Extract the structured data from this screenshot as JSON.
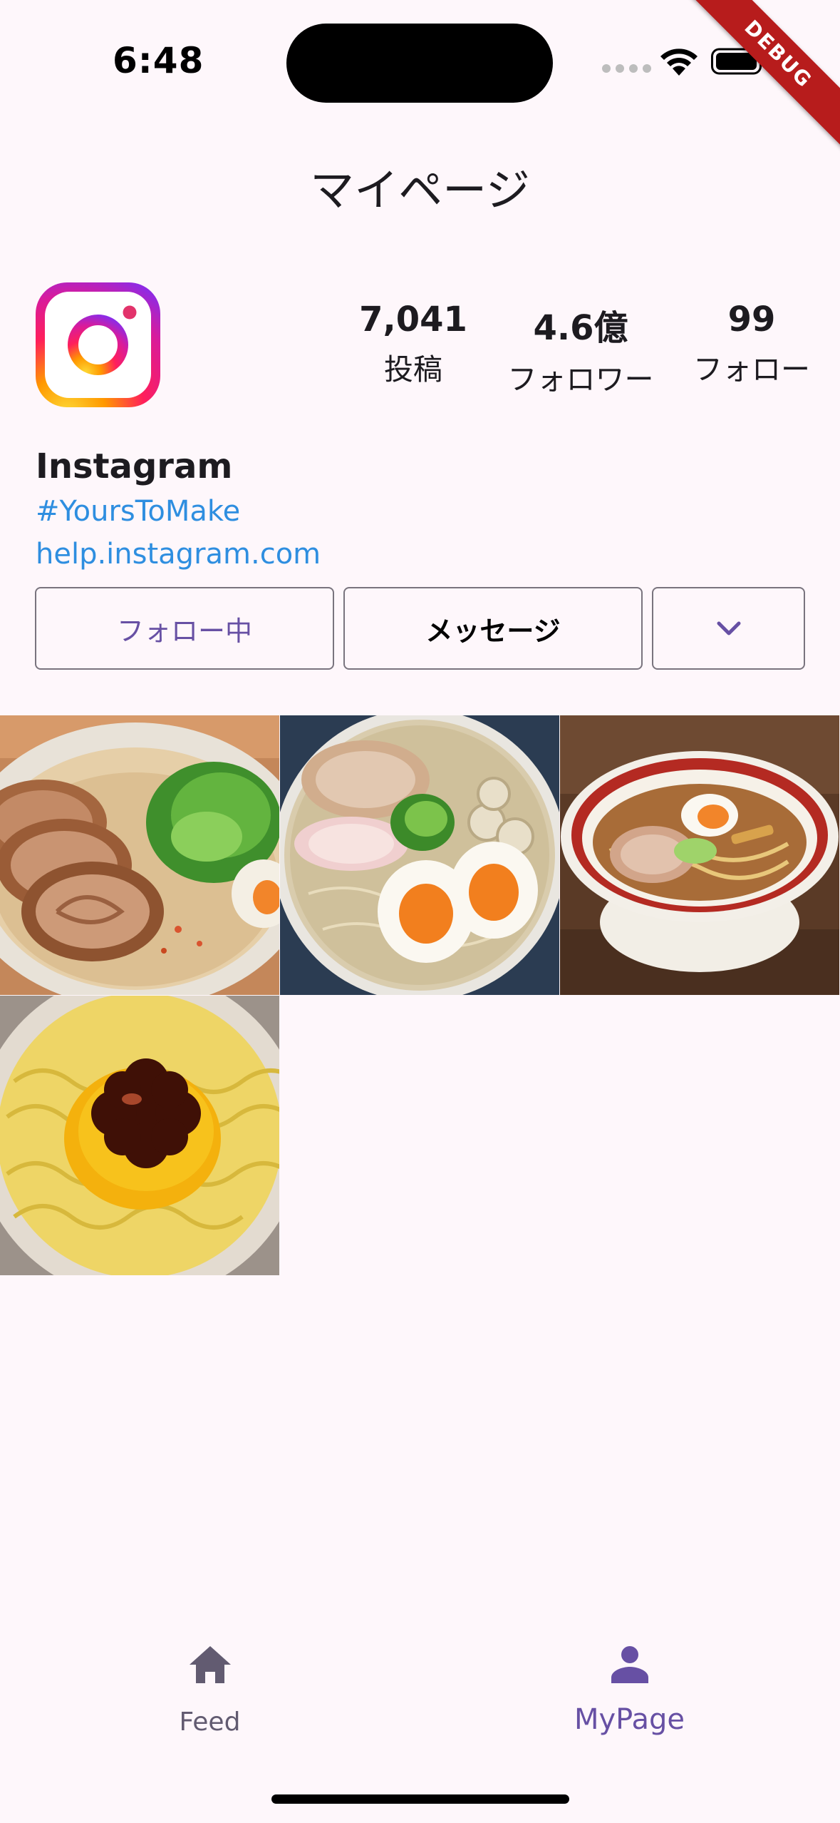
{
  "status_bar": {
    "time": "6:48"
  },
  "debug_label": "DEBUG",
  "page": {
    "title": "マイページ"
  },
  "profile": {
    "name": "Instagram",
    "hashtag": "#YoursToMake",
    "link": "help.instagram.com",
    "stats": [
      {
        "value": "7,041",
        "label": "投稿"
      },
      {
        "value": "4.6億",
        "label": "フォロワー"
      },
      {
        "value": "99",
        "label": "フォロー"
      }
    ]
  },
  "actions": {
    "follow_label": "フォロー中",
    "message_label": "メッセージ",
    "more_icon": "chevron-down-icon"
  },
  "posts": [
    {
      "icon": "ramen-photo-chashu"
    },
    {
      "icon": "ramen-photo-eggs"
    },
    {
      "icon": "ramen-photo-shoyu"
    },
    {
      "icon": "ramen-photo-pudding"
    }
  ],
  "nav": {
    "items": [
      {
        "label": "Feed",
        "icon": "home-icon",
        "selected": false
      },
      {
        "label": "MyPage",
        "icon": "person-icon",
        "selected": true
      }
    ]
  },
  "colors": {
    "accent": "#6750a4",
    "link": "#2e8ee0",
    "background": "#fef7fb",
    "debug": "#b71c1c"
  }
}
